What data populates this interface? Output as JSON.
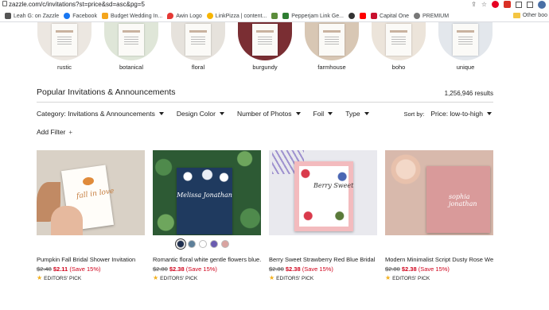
{
  "browser": {
    "url": "zazzle.com/c/invitations?st=price&sd=asc&pg=5",
    "bookmarks": [
      {
        "label": "Leah G: on Zazzle",
        "color": "#555555"
      },
      {
        "label": "Facebook",
        "color": "#1877f2"
      },
      {
        "label": "Budget Wedding In...",
        "color": "#f4a51c"
      },
      {
        "label": "Awin Logo",
        "color": "#e53935"
      },
      {
        "label": "LinkPizza | content...",
        "color": "#f7b500"
      },
      {
        "label": "",
        "color": "#5b8c3a"
      },
      {
        "label": "Pepperjam Link Ge...",
        "color": "#2e7d32"
      },
      {
        "label": "",
        "color": "#333333"
      },
      {
        "label": "",
        "color": "#ff0000"
      },
      {
        "label": "Capital One",
        "color": "#c8102e"
      },
      {
        "label": "PREMIUM",
        "color": "#777777"
      }
    ],
    "other_bookmarks": "Other boo"
  },
  "categories": [
    {
      "label": "rustic"
    },
    {
      "label": "botanical"
    },
    {
      "label": "floral"
    },
    {
      "label": "burgundy"
    },
    {
      "label": "farmhouse"
    },
    {
      "label": "boho"
    },
    {
      "label": "unique"
    }
  ],
  "section": {
    "title": "Popular Invitations & Announcements",
    "results": "1,256,946 results"
  },
  "filters": {
    "category": "Category: Invitations & Announcements",
    "design_color": "Design Color",
    "number_of_photos": "Number of Photos",
    "foil": "Foil",
    "type": "Type",
    "sort_label": "Sort by:",
    "sort_value": "Price: low-to-high",
    "add_filter": "Add Filter",
    "add_filter_icon": "+"
  },
  "products": [
    {
      "title": "Pumpkin Fall Bridal Shower Invitation",
      "old_price": "$2.48",
      "new_price": "$2.11",
      "save": "(Save 15%)",
      "badge": "EDITORS' PICK",
      "thumb_text": "fall in love"
    },
    {
      "title": "Romantic floral white gentle flowers blue...",
      "old_price": "$2.80",
      "new_price": "$2.38",
      "save": "(Save 15%)",
      "badge": "EDITORS' PICK",
      "thumb_text": "Melissa Jonathan"
    },
    {
      "title": "Berry Sweet Strawberry Red Blue Bridal ...",
      "old_price": "$2.80",
      "new_price": "$2.38",
      "save": "(Save 15%)",
      "badge": "EDITORS' PICK",
      "thumb_text": "Berry Sweet"
    },
    {
      "title": "Modern Minimalist Script Dusty Rose We...",
      "old_price": "$2.80",
      "new_price": "$2.38",
      "save": "(Save 15%)",
      "badge": "EDITORS' PICK",
      "thumb_text": "sophia jonathan"
    }
  ],
  "swatches": [
    "#1f2f4f",
    "#5d7f99",
    "#ffffff",
    "#6a5bb0",
    "#d9a3a0"
  ]
}
